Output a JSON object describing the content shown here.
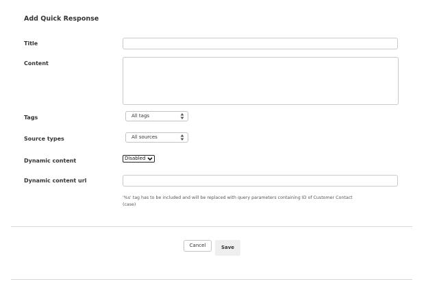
{
  "form": {
    "title": "Add Quick Response",
    "title_label": "Title",
    "title_value": "",
    "content_label": "Content",
    "content_value": "",
    "tags_label": "Tags",
    "tags_selected": "All tags",
    "source_types_label": "Source types",
    "source_types_selected": "All sources",
    "dynamic_content_label": "Dynamic content",
    "dynamic_content_selected": "Disabled",
    "dynamic_url_label": "Dynamic content url",
    "dynamic_url_value": "",
    "dynamic_url_hint_line1": "'%s' tag has to be included and will be replaced with query parameters containing ID of Customer Contact",
    "dynamic_url_hint_line2": "(case)"
  },
  "actions": {
    "cancel_label": "Cancel",
    "save_label": "Save"
  },
  "icons": {
    "select_arrows": "updown-icon",
    "dropdown_arrow": "chevron-down-icon"
  }
}
